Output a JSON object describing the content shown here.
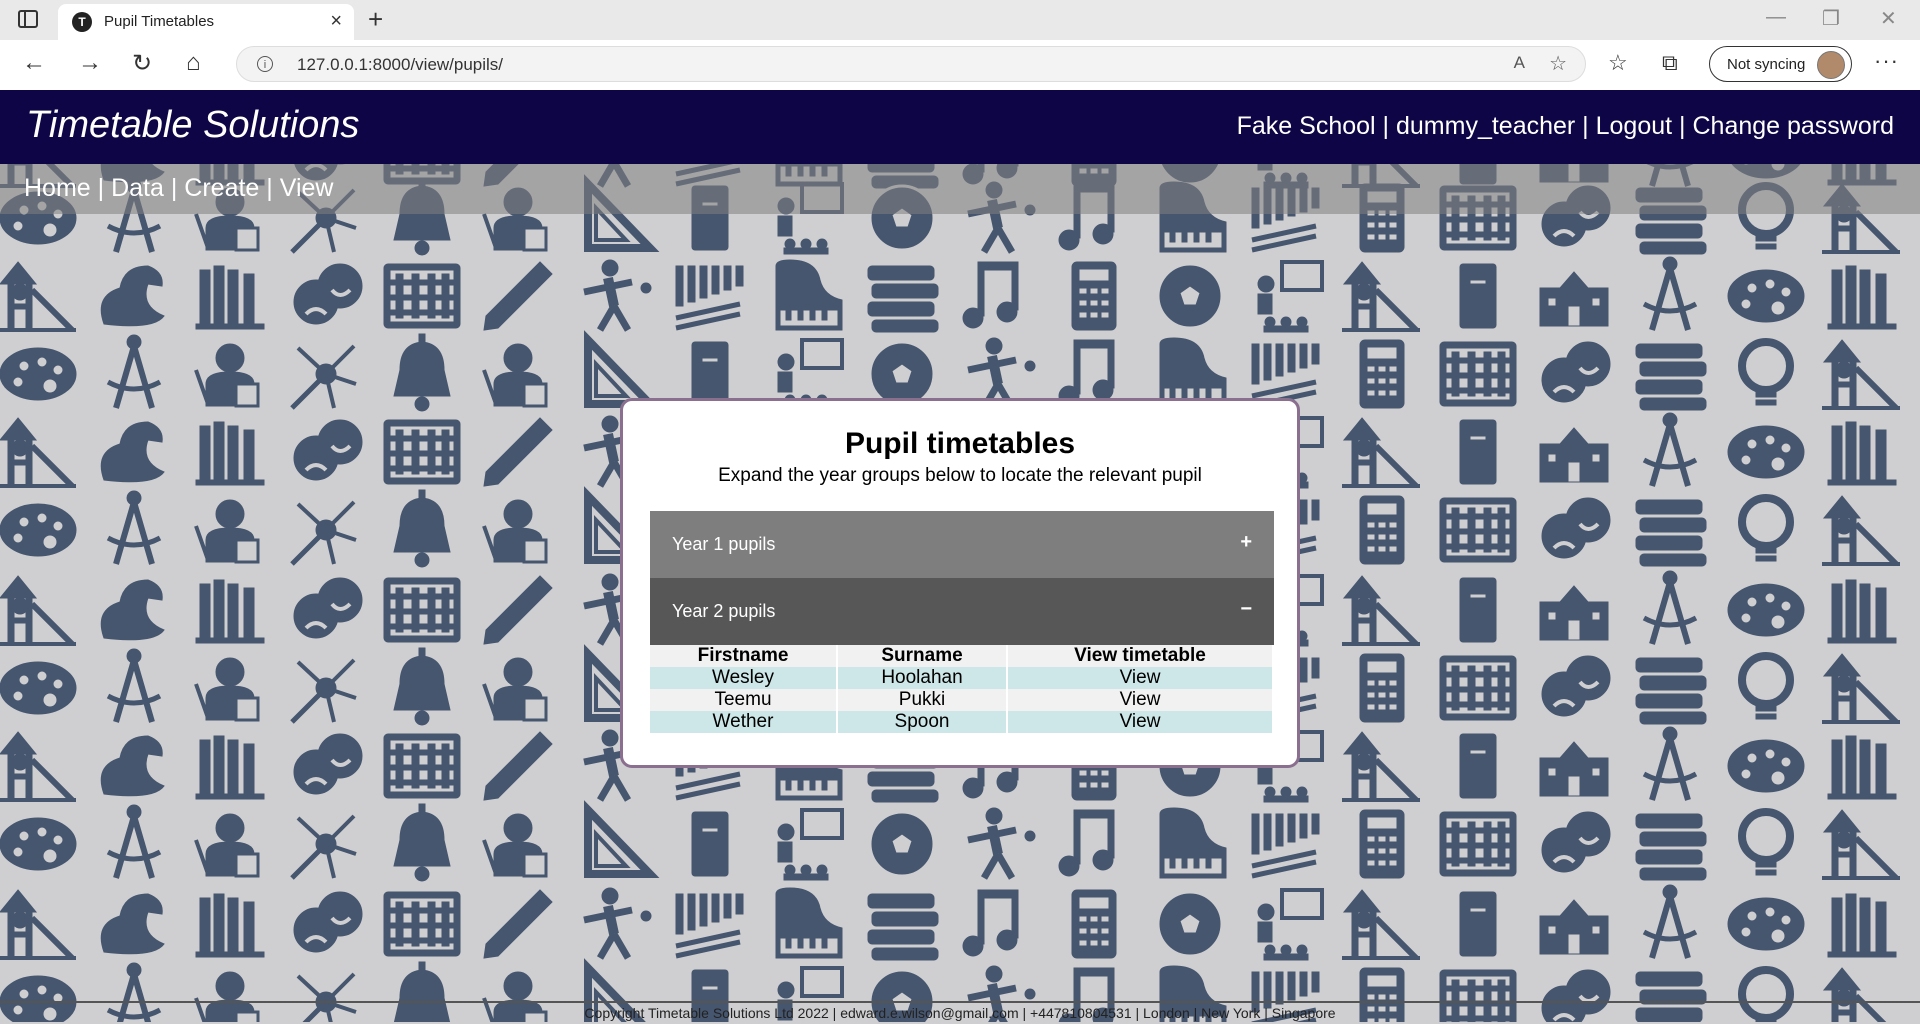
{
  "browser": {
    "tab_title": "Pupil Timetables",
    "favicon_letter": "T",
    "url": "127.0.0.1:8000/view/pupils/",
    "sync_label": "Not syncing"
  },
  "header": {
    "site_title": "Timetable Solutions",
    "school": "Fake School",
    "username": "dummy_teacher",
    "logout": "Logout",
    "change_password": "Change password",
    "separator": " | "
  },
  "nav": {
    "home": "Home",
    "data": "Data",
    "create": "Create",
    "view": "View",
    "separator": " | "
  },
  "modal": {
    "title": "Pupil timetables",
    "subtitle": "Expand the year groups below to locate the relevant pupil",
    "groups": [
      {
        "label": "Year 1 pupils",
        "toggle": "+"
      },
      {
        "label": "Year 2 pupils",
        "toggle": "−"
      }
    ],
    "table": {
      "headers": [
        "Firstname",
        "Surname",
        "View timetable"
      ],
      "rows": [
        {
          "firstname": "Wesley",
          "surname": "Hoolahan",
          "link": "View"
        },
        {
          "firstname": "Teemu",
          "surname": "Pukki",
          "link": "View"
        },
        {
          "firstname": "Wether",
          "surname": "Spoon",
          "link": "View"
        }
      ]
    }
  },
  "footer": {
    "text": "Copyright Timetable Solutions Ltd 2022 | edward.e.wilson@gmail.com | +447810804531 | London | New York | Singapore"
  },
  "colors": {
    "header_bg": "#0d0545",
    "icon_color": "#46566f",
    "background": "#cfcfd1",
    "modal_border": "#8a6f8f"
  }
}
